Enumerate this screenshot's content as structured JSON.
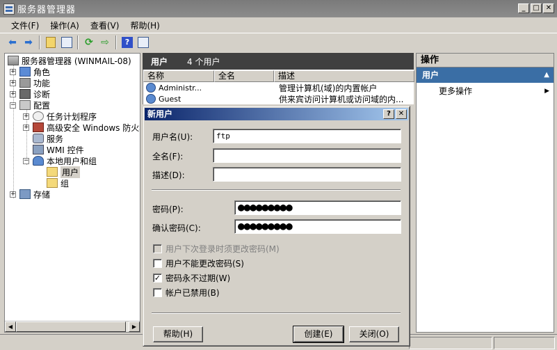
{
  "window": {
    "title": "服务器管理器"
  },
  "menu": [
    "文件(F)",
    "操作(A)",
    "查看(V)",
    "帮助(H)"
  ],
  "tree": {
    "root": "服务器管理器 (WINMAIL-08)",
    "roles": "角色",
    "features": "功能",
    "diagnostics": "诊断",
    "configuration": "配置",
    "task_scheduler": "任务计划程序",
    "firewall": "高级安全 Windows 防火墙",
    "services": "服务",
    "wmi": "WMI 控件",
    "local_users_groups": "本地用户和组",
    "users": "用户",
    "groups": "组",
    "storage": "存储"
  },
  "center": {
    "title": "用户",
    "count": "4 个用户",
    "columns": [
      "名称",
      "全名",
      "描述"
    ],
    "rows": [
      {
        "name": "Administr...",
        "fullname": "",
        "desc": "管理计算机(域)的内置帐户"
      },
      {
        "name": "Guest",
        "fullname": "",
        "desc": "供来宾访问计算机或访问域的内..."
      }
    ]
  },
  "actions": {
    "header": "操作",
    "section": "用户",
    "more": "更多操作"
  },
  "dialog": {
    "title": "新用户",
    "help_btn": "?",
    "close_btn": "✕",
    "username_label": "用户名(U):",
    "username_value": "ftp",
    "fullname_label": "全名(F):",
    "fullname_value": "",
    "desc_label": "描述(D):",
    "desc_value": "",
    "password_label": "密码(P):",
    "password_value": "●●●●●●●●●",
    "confirm_label": "确认密码(C):",
    "confirm_value": "●●●●●●●●●",
    "checkboxes": [
      {
        "label": "用户下次登录时须更改密码(M)",
        "checked": false,
        "disabled": true
      },
      {
        "label": "用户不能更改密码(S)",
        "checked": false,
        "disabled": false
      },
      {
        "label": "密码永不过期(W)",
        "checked": true,
        "disabled": false
      },
      {
        "label": "帐户已禁用(B)",
        "checked": false,
        "disabled": false
      }
    ],
    "help_button": "帮助(H)",
    "create_button": "创建(E)",
    "close_button": "关闭(O)"
  }
}
